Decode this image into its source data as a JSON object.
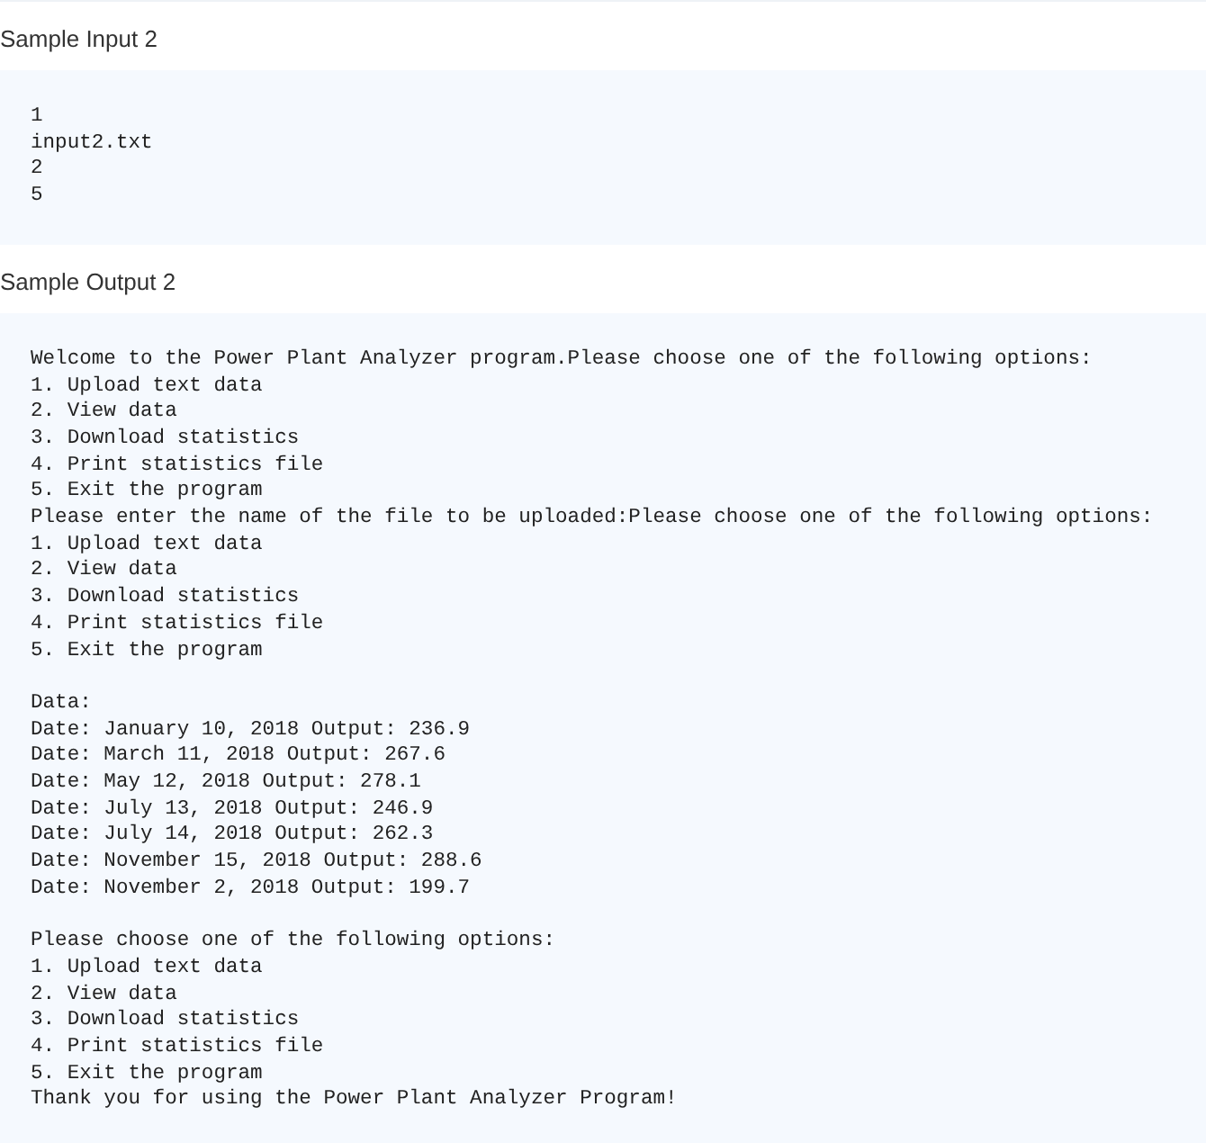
{
  "sections": [
    {
      "heading": "Sample Input 2",
      "blocks": [
        [
          "1",
          "input2.txt",
          "2",
          "5"
        ]
      ]
    },
    {
      "heading": "Sample Output 2",
      "blocks": [
        [
          "Welcome to the Power Plant Analyzer program.Please choose one of the following options:",
          "1. Upload text data",
          "2. View data",
          "3. Download statistics",
          "4. Print statistics file",
          "5. Exit the program",
          "Please enter the name of the file to be uploaded:Please choose one of the following options:",
          "1. Upload text data",
          "2. View data",
          "3. Download statistics",
          "4. Print statistics file",
          "5. Exit the program"
        ],
        [
          "Data:",
          "Date: January 10, 2018 Output: 236.9",
          "Date: March 11, 2018 Output: 267.6",
          "Date: May 12, 2018 Output: 278.1",
          "Date: July 13, 2018 Output: 246.9",
          "Date: July 14, 2018 Output: 262.3",
          "Date: November 15, 2018 Output: 288.6",
          "Date: November 2, 2018 Output: 199.7"
        ],
        [
          "Please choose one of the following options:",
          "1. Upload text data",
          "2. View data",
          "3. Download statistics",
          "4. Print statistics file",
          "5. Exit the program",
          "Thank you for using the Power Plant Analyzer Program!"
        ]
      ]
    }
  ]
}
